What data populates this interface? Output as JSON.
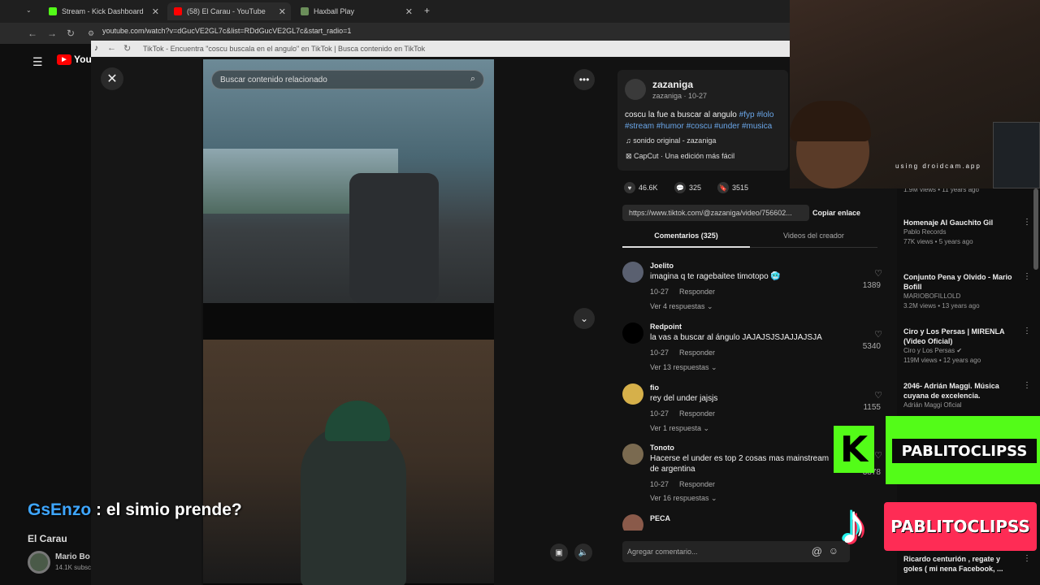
{
  "browser": {
    "tabs": [
      {
        "label": "Stream - Kick Dashboard",
        "color": "#53fc18"
      },
      {
        "label": "(58) El Carau - YouTube",
        "color": "#ff0000"
      },
      {
        "label": "Haxball Play",
        "color": "#6b8e5a"
      }
    ],
    "url": "youtube.com/watch?v=dGucVE2GL7c&list=RDdGucVE2GL7c&start_radio=1"
  },
  "popup": {
    "title": "TikTok - Encuentra \"coscu buscala en el angulo\" en TikTok | Busca contenido en TikTok",
    "search_placeholder": "Buscar contenido relacionado"
  },
  "post": {
    "author": "zazaniga",
    "author_sub": "zazaniga · 10-27",
    "caption_text": "coscu la fue a buscar al angulo ",
    "hashtags_1": "#fyp #lolo",
    "hashtags_2": "#stream #humor #coscu #under #musica",
    "sound": "sonido original - zazaniga",
    "capcut": "CapCut · Una edición más fácil",
    "likes": "46.6K",
    "comments": "325",
    "saves": "3515",
    "link": "https://www.tiktok.com/@zazaniga/video/756602...",
    "copy_label": "Copiar enlace",
    "tab_comments": "Comentarios (325)",
    "tab_creator": "Videos del creador",
    "add_comment_placeholder": "Agregar comentario..."
  },
  "comments": [
    {
      "user": "Joelito",
      "text": "imagina q te ragebaitee timotopo 🥶",
      "date": "10-27",
      "reply": "Responder",
      "more": "Ver 4 respuestas",
      "likes": "1389",
      "avatar": "#5a6070"
    },
    {
      "user": "Redpoint",
      "text": "la vas a buscar al ángulo JAJAJSJSJAJJAJSJA",
      "date": "10-27",
      "reply": "Responder",
      "more": "Ver 13 respuestas",
      "likes": "5340",
      "avatar": "#000000"
    },
    {
      "user": "fio",
      "text": "rey del under jajsjs",
      "date": "10-27",
      "reply": "Responder",
      "more": "Ver 1 respuesta",
      "likes": "1155",
      "avatar": "#d6b04a"
    },
    {
      "user": "Tonoto",
      "text": "Hacerse el under es top 2 cosas mas mainstream de argentina",
      "date": "10-27",
      "reply": "Responder",
      "more": "Ver 16 respuestas",
      "likes": "3878",
      "avatar": "#7a6a50"
    },
    {
      "user": "PECA",
      "text": "",
      "date": "",
      "reply": "",
      "more": "",
      "likes": "",
      "avatar": "#8a5a4a"
    }
  ],
  "youtube": {
    "channel": "El Carau",
    "sub_channel": "Mario Bo",
    "sub_count": "14.1K subsc",
    "chat_user": "GsEnzo",
    "chat_msg": " : el simio prende?"
  },
  "sidebar": [
    {
      "title": "",
      "channel": "",
      "meta": "1.9M views • 11 years ago"
    },
    {
      "title": "Homenaje Al Gauchito Gil",
      "channel": "Pablo Records",
      "meta": "77K views • 5 years ago"
    },
    {
      "title": "Conjunto Pena y Olvido - Mario Bofill",
      "channel": "MARIOBOFILLOLD",
      "meta": "3.2M views • 13 years ago"
    },
    {
      "title": "Ciro y Los Persas | MIRENLA (Video Oficial)",
      "channel": "Ciro y Los Persas ✔",
      "meta": "119M views • 12 years ago"
    },
    {
      "title": "2046- Adrián Maggi. Música cuyana de excelencia.",
      "channel": "Adrián Maggi Oficial",
      "meta": ""
    },
    {
      "title": "Ricardo centurión , regate y goles ( mi nena Facebook, ...",
      "channel": "",
      "meta": ""
    }
  ],
  "webcam": {
    "text": "using droidcam.app"
  },
  "overlays": {
    "kick_letter": "K",
    "kick_name": "PABLITOCLIPSS",
    "tiktok_name": "PABLITOCLIPSS",
    "tiktok_glyph": "♪"
  },
  "icons": [
    "close-icon",
    "more-icon",
    "chevron-down-icon",
    "search-icon",
    "heart-icon",
    "comment-icon",
    "bookmark-icon",
    "music-note-icon",
    "capcut-icon",
    "at-icon",
    "emoji-icon",
    "volume-icon",
    "mini-player-icon",
    "menu-icon"
  ]
}
